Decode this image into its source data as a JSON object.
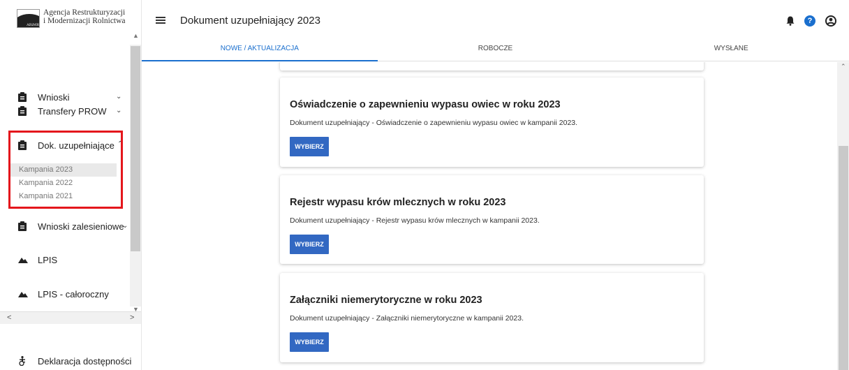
{
  "app": {
    "logo_line1": "Agencja Restrukturyzacji",
    "logo_line2": "i Modernizacji Rolnictwa",
    "logo_badge": "ARiMR"
  },
  "sidebar": {
    "items": [
      {
        "label": "Wnioski",
        "icon": "clipboard-icon",
        "chevron": "expand"
      },
      {
        "label": "Transfery PROW",
        "icon": "clipboard-icon",
        "chevron": "expand"
      },
      {
        "label": "Dok. uzupełniające",
        "icon": "clipboard-icon",
        "chevron": "collapse"
      },
      {
        "label": "Wnioski zalesieniowe",
        "icon": "clipboard-icon",
        "chevron": "expand"
      },
      {
        "label": "LPIS",
        "icon": "terrain-icon"
      },
      {
        "label": "LPIS - całoroczny",
        "icon": "terrain-icon"
      },
      {
        "label": "Deklaracja dostępności",
        "icon": "accessibility-icon"
      }
    ],
    "sub_items": [
      "Kampania 2023",
      "Kampania 2022",
      "Kampania 2021"
    ],
    "active_sub": "Kampania 2023"
  },
  "header": {
    "title": "Dokument uzupełniający 2023"
  },
  "tabs": [
    {
      "label": "NOWE / AKTUALIZACJA",
      "active": true
    },
    {
      "label": "ROBOCZE",
      "active": false
    },
    {
      "label": "WYSŁANE",
      "active": false
    }
  ],
  "cards": [
    {
      "title": "Oświadczenie o zapewnieniu wypasu owiec w roku 2023",
      "description": "Dokument uzupełniający - Oświadczenie o zapewnieniu wypasu owiec w kampanii 2023.",
      "button": "WYBIERZ"
    },
    {
      "title": "Rejestr wypasu krów mlecznych w roku 2023",
      "description": "Dokument uzupełniający - Rejestr wypasu krów mlecznych w kampanii 2023.",
      "button": "WYBIERZ"
    },
    {
      "title": "Załączniki niemerytoryczne w roku 2023",
      "description": "Dokument uzupełniający - Załączniki niemerytoryczne w kampanii 2023.",
      "button": "WYBIERZ"
    }
  ],
  "colors": {
    "accent": "#1a6fce",
    "button": "#3268c2",
    "highlight": "#e4161c"
  }
}
